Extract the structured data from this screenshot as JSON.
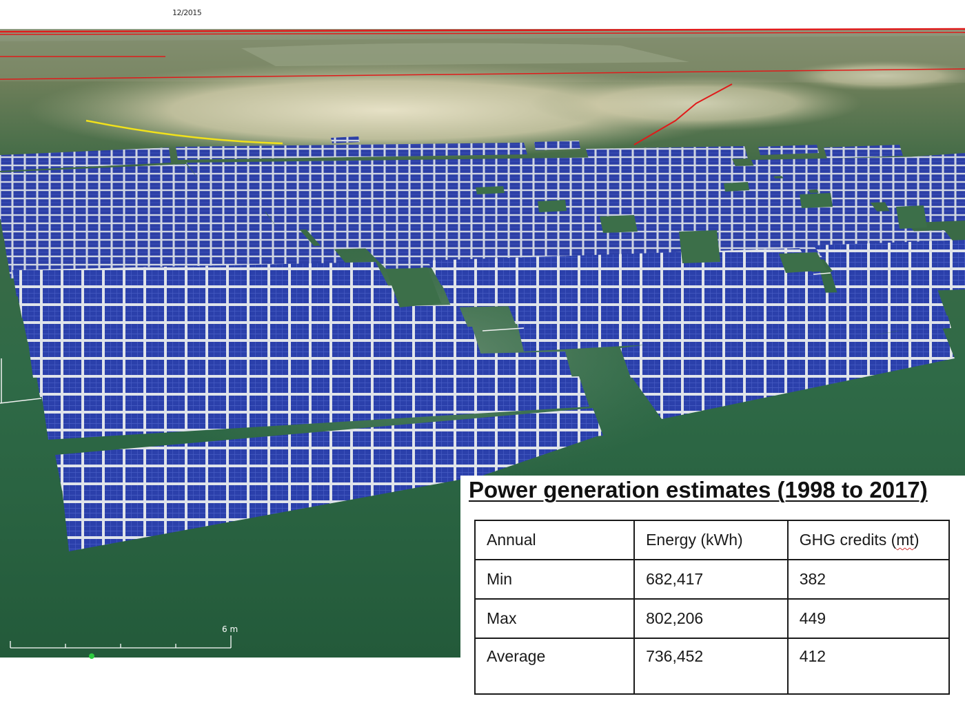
{
  "viewer": {
    "date_stamp": "12/2015",
    "scale_bar_label": "6 m"
  },
  "colors": {
    "panel_blue": "#2a3fa8",
    "panel_frame": "#d9dde6",
    "grass": "#2f6b45",
    "boundary_line": "#e01a1a",
    "path_yellow": "#f2e21a"
  },
  "estimates": {
    "title": "Power generation estimates (1998 to 2017)",
    "columns": [
      "Annual",
      "Energy (kWh)",
      "GHG credits (mt)"
    ],
    "rows": [
      {
        "label": "Min",
        "energy": "682,417",
        "ghg": "382"
      },
      {
        "label": "Max",
        "energy": "802,206",
        "ghg": "449"
      },
      {
        "label": "Average",
        "energy": "736,452",
        "ghg": "412"
      }
    ]
  }
}
